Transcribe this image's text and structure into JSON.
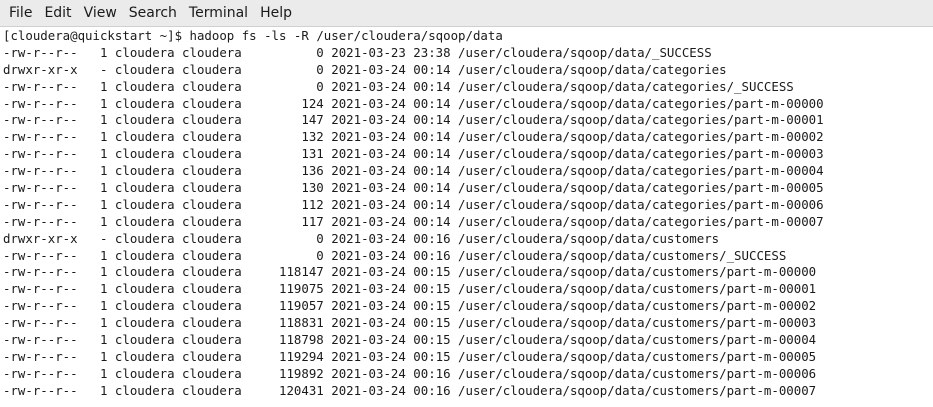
{
  "menubar": {
    "items": [
      "File",
      "Edit",
      "View",
      "Search",
      "Terminal",
      "Help"
    ]
  },
  "terminal": {
    "prompt": "[cloudera@quickstart ~]$ ",
    "command": "hadoop fs -ls -R /user/cloudera/sqoop/data",
    "output_lines": [
      "-rw-r--r--   1 cloudera cloudera          0 2021-03-23 23:38 /user/cloudera/sqoop/data/_SUCCESS",
      "drwxr-xr-x   - cloudera cloudera          0 2021-03-24 00:14 /user/cloudera/sqoop/data/categories",
      "-rw-r--r--   1 cloudera cloudera          0 2021-03-24 00:14 /user/cloudera/sqoop/data/categories/_SUCCESS",
      "-rw-r--r--   1 cloudera cloudera        124 2021-03-24 00:14 /user/cloudera/sqoop/data/categories/part-m-00000",
      "-rw-r--r--   1 cloudera cloudera        147 2021-03-24 00:14 /user/cloudera/sqoop/data/categories/part-m-00001",
      "-rw-r--r--   1 cloudera cloudera        132 2021-03-24 00:14 /user/cloudera/sqoop/data/categories/part-m-00002",
      "-rw-r--r--   1 cloudera cloudera        131 2021-03-24 00:14 /user/cloudera/sqoop/data/categories/part-m-00003",
      "-rw-r--r--   1 cloudera cloudera        136 2021-03-24 00:14 /user/cloudera/sqoop/data/categories/part-m-00004",
      "-rw-r--r--   1 cloudera cloudera        130 2021-03-24 00:14 /user/cloudera/sqoop/data/categories/part-m-00005",
      "-rw-r--r--   1 cloudera cloudera        112 2021-03-24 00:14 /user/cloudera/sqoop/data/categories/part-m-00006",
      "-rw-r--r--   1 cloudera cloudera        117 2021-03-24 00:14 /user/cloudera/sqoop/data/categories/part-m-00007",
      "drwxr-xr-x   - cloudera cloudera          0 2021-03-24 00:16 /user/cloudera/sqoop/data/customers",
      "-rw-r--r--   1 cloudera cloudera          0 2021-03-24 00:16 /user/cloudera/sqoop/data/customers/_SUCCESS",
      "-rw-r--r--   1 cloudera cloudera     118147 2021-03-24 00:15 /user/cloudera/sqoop/data/customers/part-m-00000",
      "-rw-r--r--   1 cloudera cloudera     119075 2021-03-24 00:15 /user/cloudera/sqoop/data/customers/part-m-00001",
      "-rw-r--r--   1 cloudera cloudera     119057 2021-03-24 00:15 /user/cloudera/sqoop/data/customers/part-m-00002",
      "-rw-r--r--   1 cloudera cloudera     118831 2021-03-24 00:15 /user/cloudera/sqoop/data/customers/part-m-00003",
      "-rw-r--r--   1 cloudera cloudera     118798 2021-03-24 00:15 /user/cloudera/sqoop/data/customers/part-m-00004",
      "-rw-r--r--   1 cloudera cloudera     119294 2021-03-24 00:15 /user/cloudera/sqoop/data/customers/part-m-00005",
      "-rw-r--r--   1 cloudera cloudera     119892 2021-03-24 00:16 /user/cloudera/sqoop/data/customers/part-m-00006",
      "-rw-r--r--   1 cloudera cloudera     120431 2021-03-24 00:16 /user/cloudera/sqoop/data/customers/part-m-00007"
    ]
  }
}
